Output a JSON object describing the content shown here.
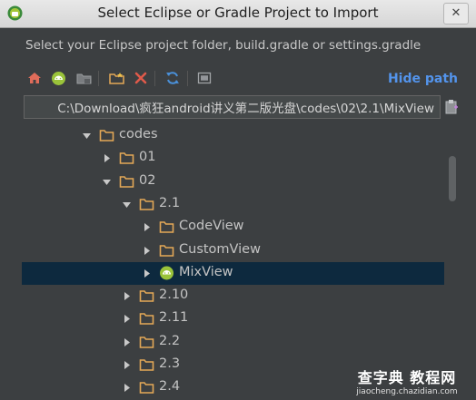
{
  "window": {
    "title": "Select Eclipse or Gradle Project to Import",
    "close_symbol": "✕"
  },
  "dialog": {
    "subtitle": "Select your Eclipse project folder, build.gradle or settings.gradle",
    "hide_path_link": "Hide path",
    "path_value": "C:\\Download\\疯狂android讲义第二版光盘\\codes\\02\\2.1\\MixView"
  },
  "toolbar": {
    "buttons": [
      {
        "name": "home-icon"
      },
      {
        "name": "android-project-icon"
      },
      {
        "name": "module-folder-icon"
      },
      {
        "name": "new-folder-icon"
      },
      {
        "name": "delete-icon"
      },
      {
        "name": "refresh-icon"
      },
      {
        "name": "show-hidden-icon"
      }
    ]
  },
  "tree": {
    "rows": [
      {
        "label": "codes",
        "expanded": true,
        "type": "folder"
      },
      {
        "label": "01",
        "expanded": false,
        "type": "folder"
      },
      {
        "label": "02",
        "expanded": true,
        "type": "folder"
      },
      {
        "label": "2.1",
        "expanded": true,
        "type": "folder"
      },
      {
        "label": "CodeView",
        "expanded": false,
        "type": "folder"
      },
      {
        "label": "CustomView",
        "expanded": false,
        "type": "folder"
      },
      {
        "label": "MixView",
        "expanded": false,
        "type": "android",
        "selected": true
      },
      {
        "label": "2.10",
        "expanded": false,
        "type": "folder"
      },
      {
        "label": "2.11",
        "expanded": false,
        "type": "folder"
      },
      {
        "label": "2.2",
        "expanded": false,
        "type": "folder"
      },
      {
        "label": "2.3",
        "expanded": false,
        "type": "folder"
      },
      {
        "label": "2.4",
        "expanded": false,
        "type": "folder"
      }
    ]
  },
  "watermark": {
    "main": "查字典 教程网",
    "sub": "jiaocheng.chazidian.com"
  },
  "colors": {
    "folder": "#e3a857",
    "android": "#9ac33a",
    "selection": "#0d293e",
    "link": "#5394ec"
  }
}
